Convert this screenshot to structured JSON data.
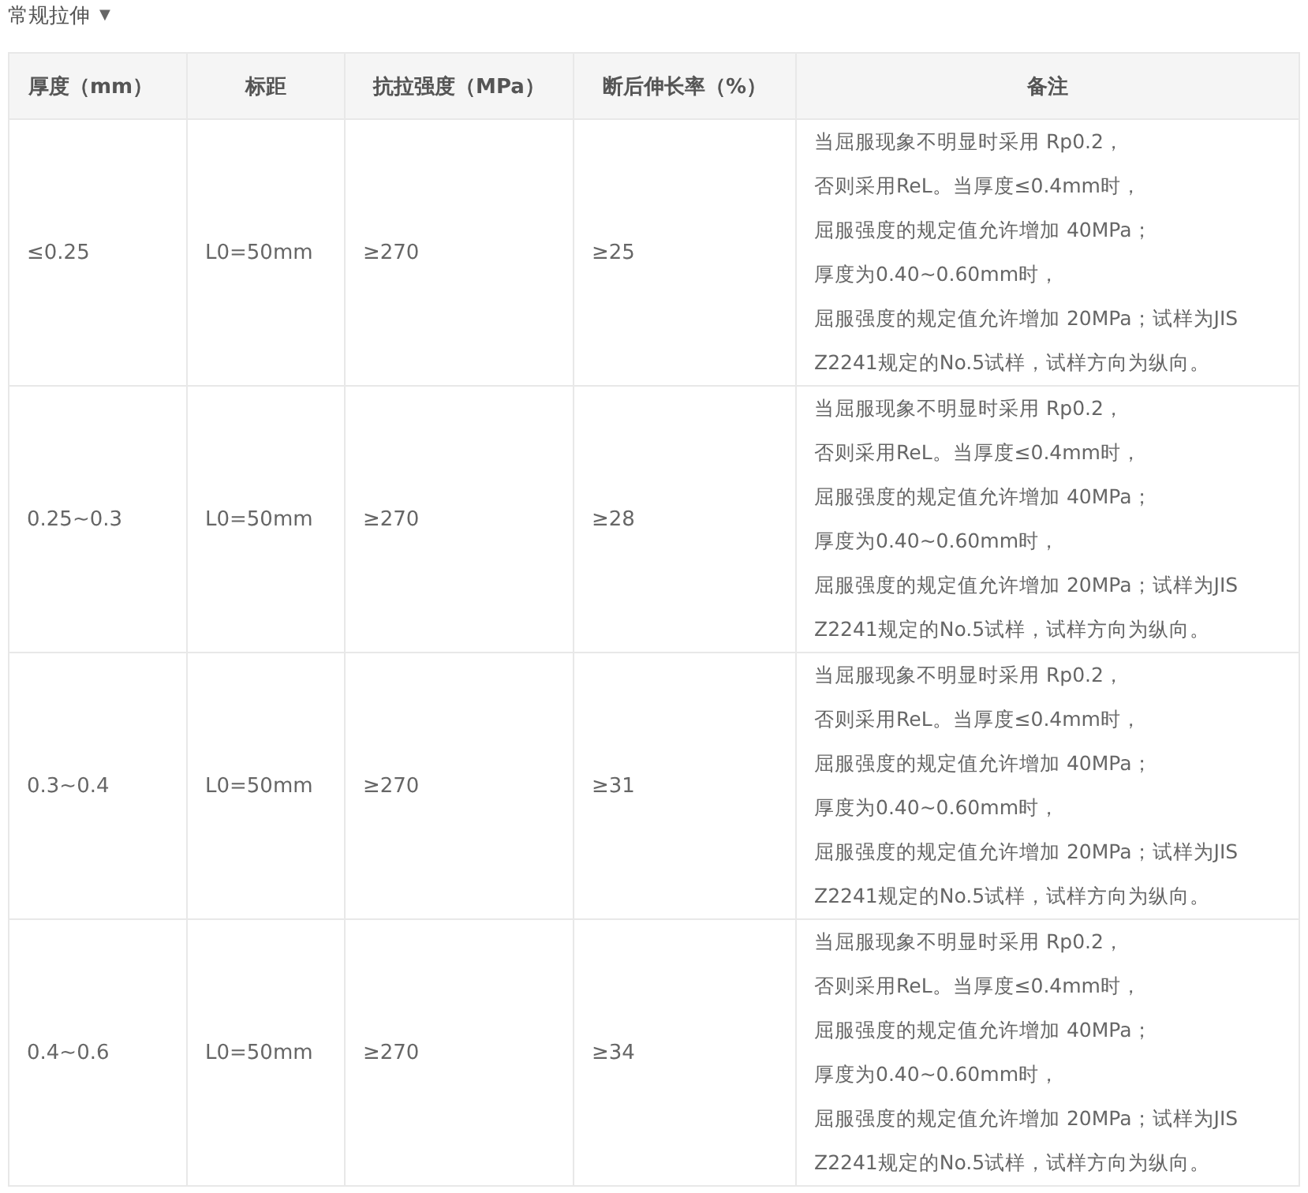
{
  "section": {
    "title": "常规拉伸",
    "toggle": "▼"
  },
  "table": {
    "columns": [
      "厚度（mm）",
      "标距",
      "抗拉强度（MPa）",
      "断后伸长率（%）",
      "备注"
    ],
    "rows": [
      {
        "cells": [
          "≤0.25",
          "L0=50mm",
          "≥270",
          "≥25"
        ],
        "note_lines": [
          "当屈服现象不明显时采用 Rp0.2，",
          "否则采用ReL。当厚度≤0.4mm时，",
          "屈服强度的规定值允许增加 40MPa；",
          "厚度为0.40~0.60mm时，",
          "屈服强度的规定值允许增加 20MPa；试样为JIS",
          "Z2241规定的No.5试样，试样方向为纵向。"
        ]
      },
      {
        "cells": [
          "0.25~0.3",
          "L0=50mm",
          "≥270",
          "≥28"
        ],
        "note_lines": [
          "当屈服现象不明显时采用 Rp0.2，",
          "否则采用ReL。当厚度≤0.4mm时，",
          "屈服强度的规定值允许增加 40MPa；",
          "厚度为0.40~0.60mm时，",
          "屈服强度的规定值允许增加 20MPa；试样为JIS",
          "Z2241规定的No.5试样，试样方向为纵向。"
        ]
      },
      {
        "cells": [
          "0.3~0.4",
          "L0=50mm",
          "≥270",
          "≥31"
        ],
        "note_lines": [
          "当屈服现象不明显时采用 Rp0.2，",
          "否则采用ReL。当厚度≤0.4mm时，",
          "屈服强度的规定值允许增加 40MPa；",
          "厚度为0.40~0.60mm时，",
          "屈服强度的规定值允许增加 20MPa；试样为JIS",
          "Z2241规定的No.5试样，试样方向为纵向。"
        ]
      },
      {
        "cells": [
          "0.4~0.6",
          "L0=50mm",
          "≥270",
          "≥34"
        ],
        "note_lines": [
          "当屈服现象不明显时采用 Rp0.2，",
          "否则采用ReL。当厚度≤0.4mm时，",
          "屈服强度的规定值允许增加 40MPa；",
          "厚度为0.40~0.60mm时，",
          "屈服强度的规定值允许增加 20MPa；试样为JIS",
          "Z2241规定的No.5试样，试样方向为纵向。"
        ]
      }
    ]
  }
}
